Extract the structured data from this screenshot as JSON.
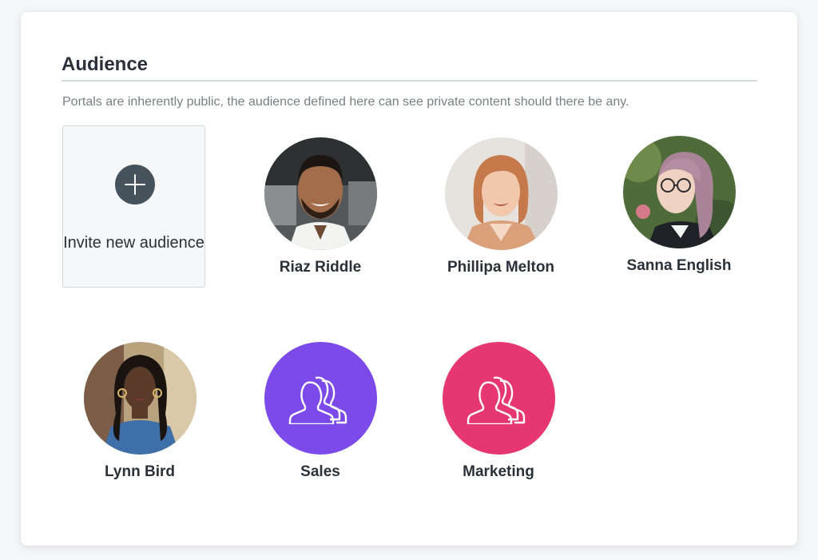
{
  "section": {
    "title": "Audience",
    "description": "Portals are inherently public, the audience defined here can see private content should there be any."
  },
  "invite": {
    "label": "Invite new audience",
    "icon": "plus-icon"
  },
  "members": [
    {
      "name": "Riaz Riddle",
      "kind": "person"
    },
    {
      "name": "Phillipa Melton",
      "kind": "person"
    },
    {
      "name": "Sanna English",
      "kind": "person"
    },
    {
      "name": "Lynn Bird",
      "kind": "person"
    },
    {
      "name": "Sales",
      "kind": "group",
      "color": "#7b4ae8",
      "icon": "users-group-icon"
    },
    {
      "name": "Marketing",
      "kind": "group",
      "color": "#e63772",
      "icon": "users-group-icon"
    }
  ],
  "colors": {
    "plus_circle": "#46525c",
    "text": "#2b3138",
    "muted_text": "#7a7f85"
  }
}
